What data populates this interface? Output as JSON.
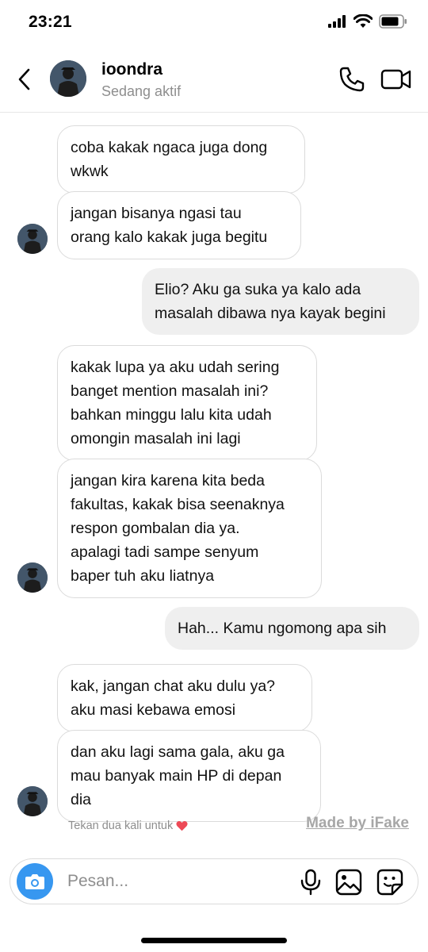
{
  "status_bar": {
    "time": "23:21"
  },
  "header": {
    "username": "ioondra",
    "status": "Sedang aktif"
  },
  "messages": [
    {
      "from": "them",
      "text": "coba kakak ngaca juga dong\nwkwk"
    },
    {
      "from": "them",
      "text": "jangan bisanya ngasi tau\norang kalo kakak juga begitu"
    },
    {
      "from": "me",
      "text": "Elio? Aku ga suka ya kalo ada\nmasalah dibawa nya kayak begini"
    },
    {
      "from": "them",
      "text": "kakak lupa ya aku udah sering\nbanget mention masalah ini?\nbahkan minggu lalu kita udah\nomongin masalah ini lagi"
    },
    {
      "from": "them",
      "text": "jangan kira karena kita beda\nfakultas, kakak bisa seenaknya\nrespon gombalan dia ya.\napalagi tadi sampe senyum\nbaper tuh aku liatnya"
    },
    {
      "from": "me",
      "text": "Hah... Kamu ngomong apa sih"
    },
    {
      "from": "them",
      "text": "kak, jangan chat aku dulu ya?\naku masi kebawa emosi"
    },
    {
      "from": "them",
      "text": "dan aku lagi sama gala, aku ga\nmau banyak main HP di depan\ndia"
    }
  ],
  "hint": {
    "text": "Tekan dua kali untuk",
    "emoji": "❤️"
  },
  "watermark": "Made by iFake",
  "composer": {
    "placeholder": "Pesan..."
  },
  "colors": {
    "accent": "#3797f0",
    "incoming_border": "#dbdbdb",
    "outgoing_bg": "#efefef",
    "heart": "#ed4956"
  },
  "icons": [
    "back-icon",
    "phone-icon",
    "video-icon",
    "camera-icon",
    "microphone-icon",
    "gallery-icon",
    "sticker-icon",
    "heart-icon"
  ]
}
